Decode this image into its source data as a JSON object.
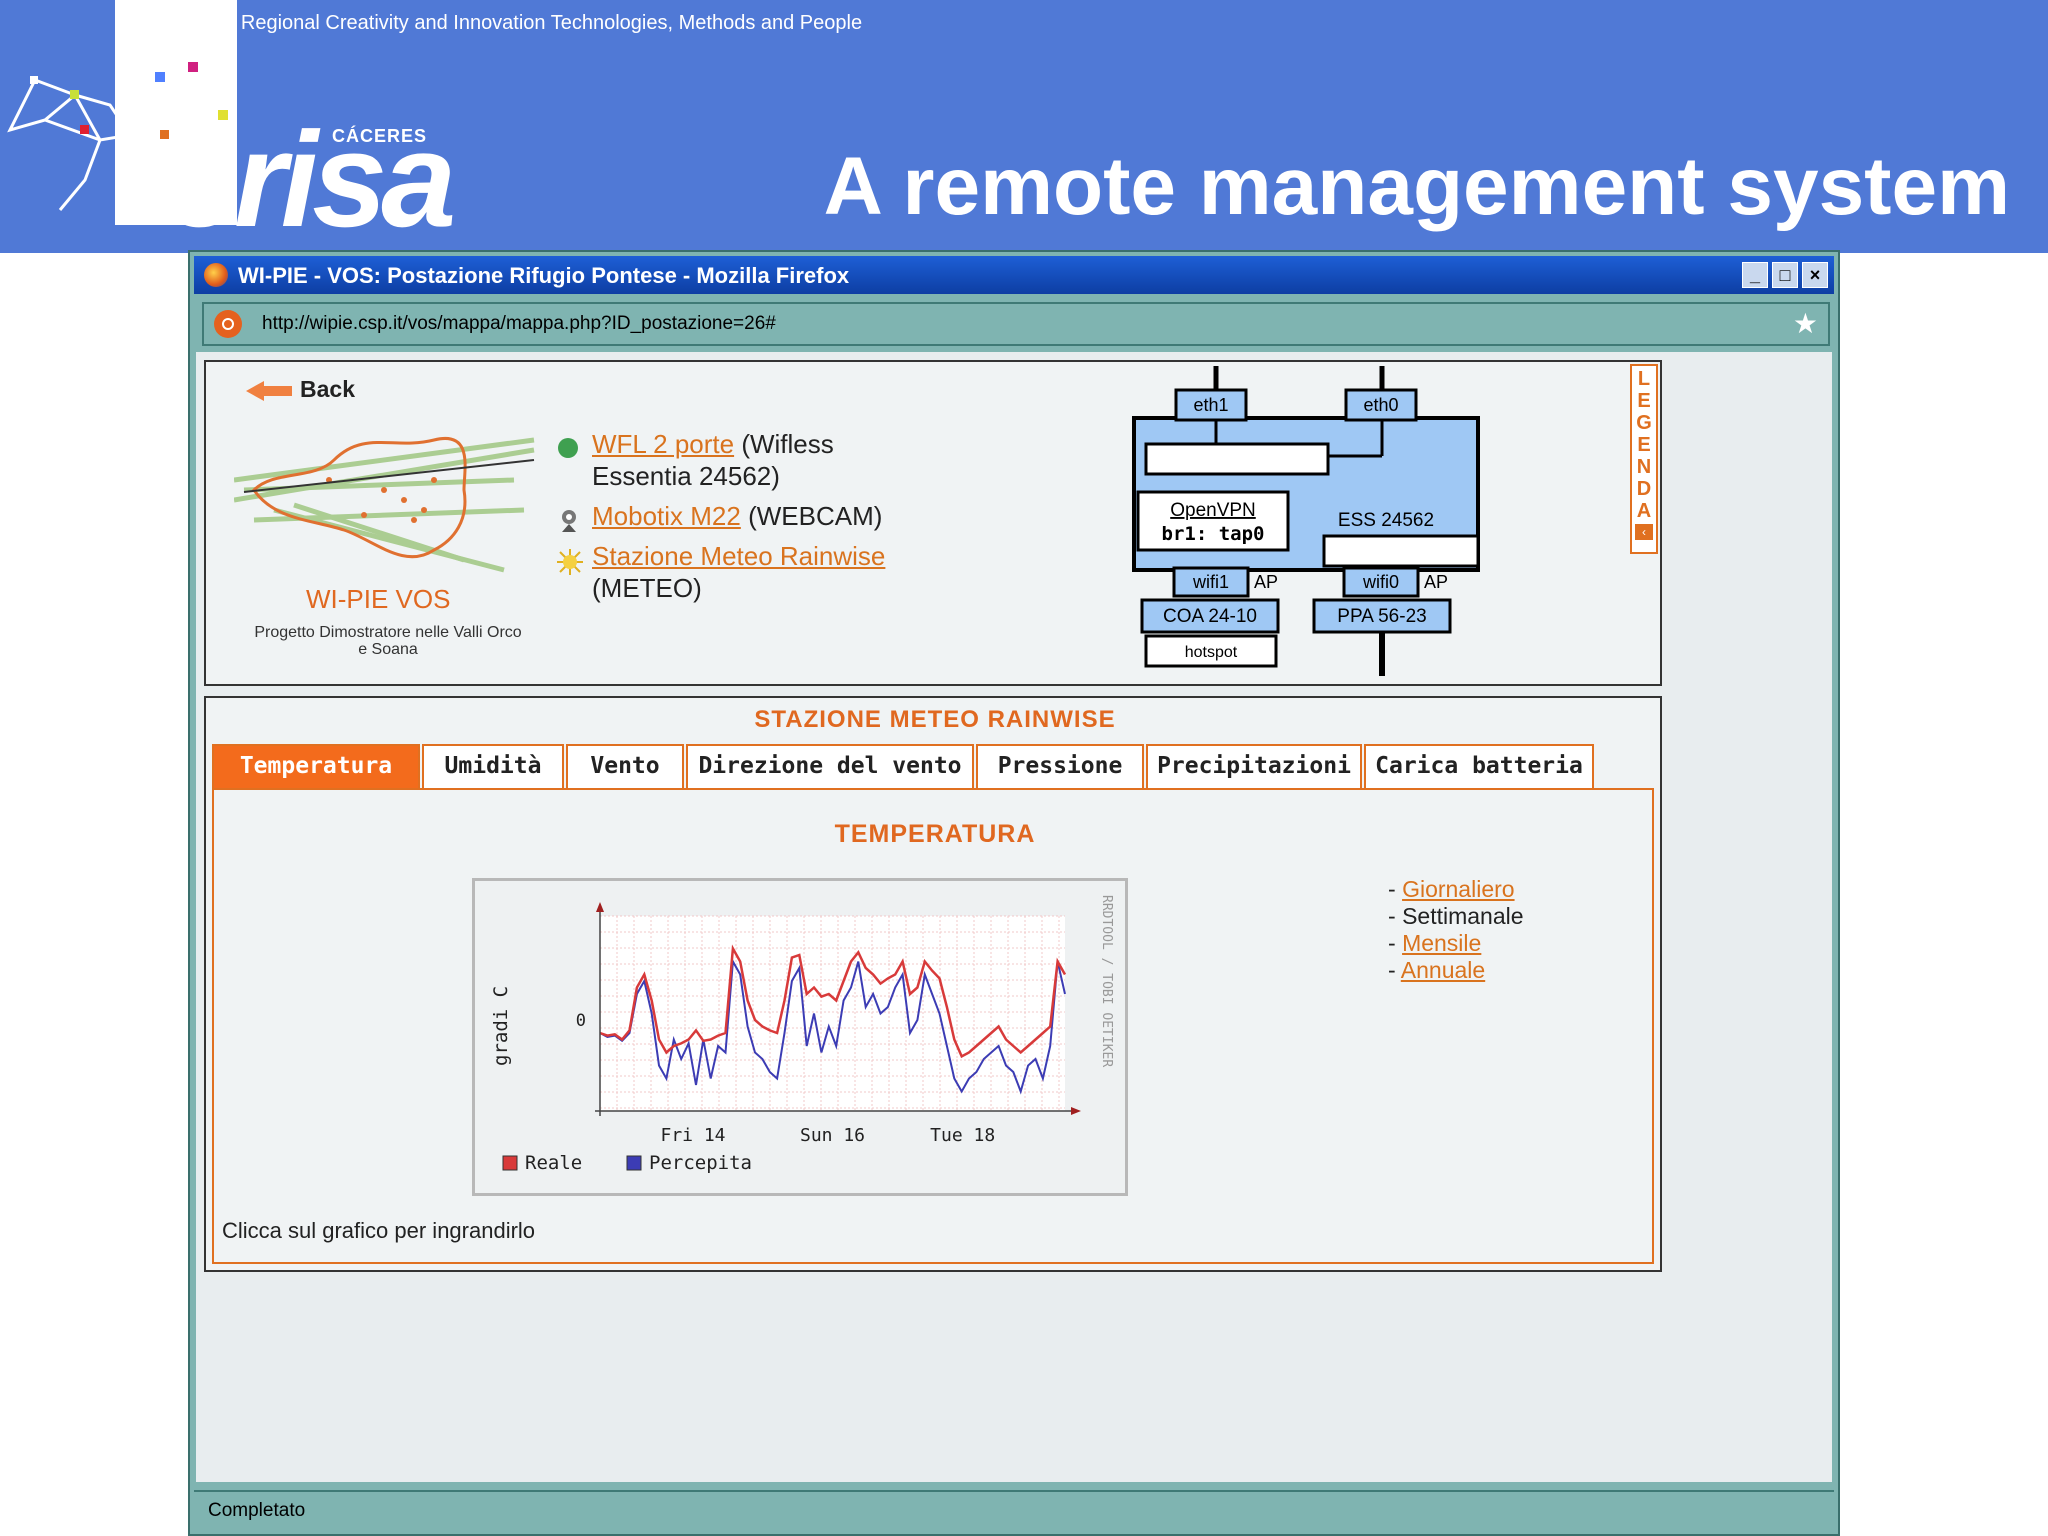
{
  "slide": {
    "tagline": "Fostering Regional Creativity and Innovation Technologies, Methods and People",
    "title": "A remote management system",
    "logo_small": "CÁCERES",
    "logo_main": "erisa"
  },
  "browser": {
    "window_title": "WI-PIE - VOS: Postazione Rifugio Pontese - Mozilla Firefox",
    "url": "http://wipie.csp.it/vos/mappa/mappa.php?ID_postazione=26#",
    "status": "Completato",
    "buttons": {
      "minimize": "_",
      "maximize": "□",
      "close": "×"
    }
  },
  "page": {
    "back_label": "Back",
    "project_name": "WI-PIE VOS",
    "project_subtitle": "Progetto Dimostratore nelle Valli Orco e Soana",
    "devices": [
      {
        "link": "WFL 2 porte",
        "detail": "(Wifless Essentia 24562)",
        "icon": "green-dot-icon"
      },
      {
        "link": "Mobotix M22",
        "detail": "(WEBCAM)",
        "icon": "webcam-icon"
      },
      {
        "link": "Stazione Meteo Rainwise",
        "detail": "(METEO)",
        "icon": "sun-icon"
      }
    ],
    "legenda_letters": [
      "L",
      "E",
      "G",
      "E",
      "N",
      "D",
      "A"
    ],
    "legenda_arrow": "‹",
    "network": {
      "eth1": "eth1",
      "eth0": "eth0",
      "openvpn": "OpenVPN",
      "bridge": "br1: tap0",
      "device": "ESS 24562",
      "wifi1": "wifi1",
      "wifi0": "wifi0",
      "ap1": "AP",
      "ap0": "AP",
      "coa": "COA 24-10",
      "ppa": "PPA 56-23",
      "hotspot": "hotspot"
    },
    "meteo": {
      "title": "STAZIONE METEO RAINWISE",
      "tabs": [
        "Temperatura",
        "Umidità",
        "Vento",
        "Direzione del vento",
        "Pressione",
        "Precipitazioni",
        "Carica batteria"
      ],
      "active_tab": "Temperatura",
      "heading": "TEMPERATURA",
      "periods": [
        {
          "label": "Giornaliero",
          "link": true
        },
        {
          "label": "Settimanale",
          "link": false
        },
        {
          "label": "Mensile",
          "link": true
        },
        {
          "label": "Annuale",
          "link": true
        }
      ],
      "hint": "Clicca sul grafico per ingrandirlo"
    }
  },
  "chart_data": {
    "type": "line",
    "title": "",
    "xlabel": "",
    "ylabel": "gradi C",
    "x_ticks": [
      "Fri 14",
      "Sun 16",
      "Tue 18"
    ],
    "y_ticks": [
      "0"
    ],
    "watermark": "RRDTOOL / TOBI OETIKER",
    "grid": true,
    "legend_position": "bottom-left",
    "colors": {
      "Reale": "#d83a3a",
      "Percepita": "#3c3cb4"
    },
    "series": [
      {
        "name": "Reale",
        "values": [
          -1.0,
          -1.2,
          -1.1,
          -1.5,
          -0.8,
          2.5,
          3.5,
          1.5,
          -1.5,
          -2.5,
          -2.0,
          -1.8,
          -1.5,
          -0.8,
          -1.6,
          -1.5,
          -1.2,
          -1.0,
          5.5,
          4.5,
          1.5,
          0.0,
          -0.5,
          -0.8,
          -1.0,
          1.5,
          4.8,
          5.0,
          2.0,
          2.5,
          1.8,
          2.0,
          1.5,
          3.0,
          4.5,
          5.2,
          4.0,
          3.5,
          2.8,
          3.2,
          3.5,
          4.5,
          2.0,
          2.5,
          4.5,
          3.8,
          3.2,
          1.0,
          -1.5,
          -2.8,
          -2.5,
          -2.0,
          -1.5,
          -1.0,
          -0.5,
          -1.5,
          -2.0,
          -2.5,
          -2.0,
          -1.5,
          -1.0,
          -0.5,
          4.5,
          3.5
        ]
      },
      {
        "name": "Percepita",
        "values": [
          -1.0,
          -1.3,
          -1.2,
          -1.6,
          -1.0,
          2.0,
          3.0,
          0.5,
          -3.5,
          -4.5,
          -1.5,
          -3.0,
          -1.8,
          -5.0,
          -1.5,
          -4.5,
          -2.0,
          -2.5,
          4.5,
          3.5,
          -0.5,
          -2.5,
          -3.0,
          -4.0,
          -4.5,
          -1.0,
          3.0,
          4.0,
          -2.0,
          0.5,
          -2.5,
          -0.5,
          -2.0,
          1.5,
          2.5,
          4.5,
          1.0,
          2.0,
          0.5,
          1.0,
          2.5,
          3.5,
          -1.0,
          0.0,
          3.5,
          2.0,
          0.5,
          -2.0,
          -4.5,
          -5.5,
          -4.5,
          -4.0,
          -3.0,
          -2.5,
          -2.0,
          -3.5,
          -4.0,
          -5.5,
          -3.5,
          -3.0,
          -4.5,
          -2.0,
          4.5,
          2.0
        ]
      }
    ]
  }
}
